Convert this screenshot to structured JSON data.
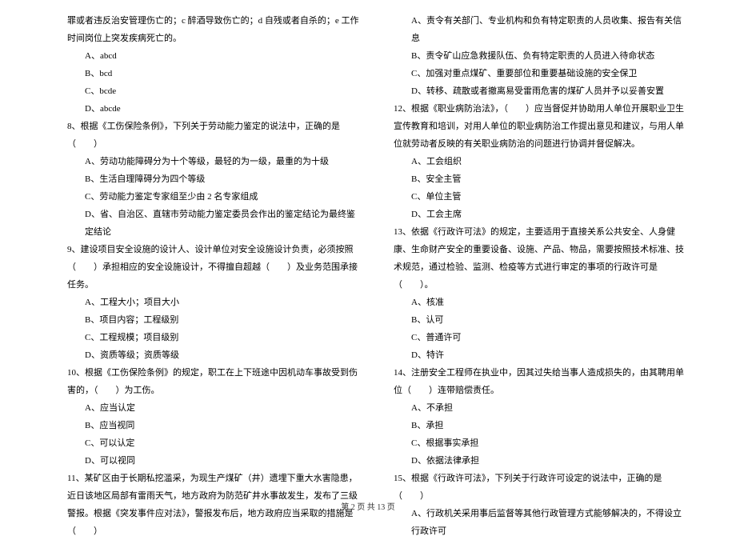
{
  "left": {
    "intro": "罪或者违反治安管理伤亡的；c 醉酒导致伤亡的；d 自残或者自杀的；e 工作时间岗位上突发疾病死亡的。",
    "q7_opts": [
      "A、abcd",
      "B、bcd",
      "C、bcde",
      "D、abcde"
    ],
    "q8_stem": "8、根据《工伤保险条例》，下列关于劳动能力鉴定的说法中，正确的是（　　）",
    "q8_opts": [
      "A、劳动功能障碍分为十个等级，最轻的为一级，最重的为十级",
      "B、生活自理障碍分为四个等级",
      "C、劳动能力鉴定专家组至少由 2 名专家组成",
      "D、省、自治区、直辖市劳动能力鉴定委员会作出的鉴定结论为最终鉴定结论"
    ],
    "q9_stem": "9、建设项目安全设施的设计人、设计单位对安全设施设计负责，必须按照（　　）承担相应的安全设施设计，不得擅自超越（　　）及业务范围承接任务。",
    "q9_opts": [
      "A、工程大小；项目大小",
      "B、项目内容；工程级别",
      "C、工程规模；项目级别",
      "D、资质等级；资质等级"
    ],
    "q10_stem": "10、根据《工伤保险条例》的规定，职工在上下班途中因机动车事故受到伤害的，（　　）为工伤。",
    "q10_opts": [
      "A、应当认定",
      "B、应当视同",
      "C、可以认定",
      "D、可以视同"
    ],
    "q11_stem": "11、某矿区由于长期私挖滥采，为现生产煤矿（井）遗埋下重大水害隐患，近日该地区局部有雷雨天气，地方政府为防范矿井水事故发生，发布了三级警报。根据《突发事件应对法》，警报发布后，地方政府应当采取的措施是（　　）"
  },
  "right": {
    "q11_opts": [
      "A、责令有关部门、专业机构和负有特定职责的人员收集、报告有关信息",
      "B、责令矿山应急救援队伍、负有特定职责的人员进入待命状态",
      "C、加强对重点煤矿、重要部位和重要基础设施的安全保卫",
      "D、转移、疏散或者撤离易受雷雨危害的煤矿人员并予以妥善安置"
    ],
    "q12_stem": "12、根据《职业病防治法》，（　　）应当督促并协助用人单位开展职业卫生宣传教育和培训，对用人单位的职业病防治工作提出意见和建议，与用人单位就劳动者反映的有关职业病防治的问题进行协调并督促解决。",
    "q12_opts": [
      "A、工会组织",
      "B、安全主管",
      "C、单位主管",
      "D、工会主席"
    ],
    "q13_stem": "13、依据《行政许可法》的规定，主要适用于直接关系公共安全、人身健康、生命财产安全的重要设备、设施、产品、物品，需要按照技术标准、技术规范，通过检验、监测、检疫等方式进行审定的事项的行政许可是（　　）。",
    "q13_opts": [
      "A、核准",
      "B、认可",
      "C、普通许可",
      "D、特许"
    ],
    "q14_stem": "14、注册安全工程师在执业中，因其过失给当事人造成损失的，由其聘用单位（　　）连带赔偿责任。",
    "q14_opts": [
      "A、不承担",
      "B、承担",
      "C、根据事实承担",
      "D、依据法律承担"
    ],
    "q15_stem": "15、根据《行政许可法》，下列关于行政许可设定的说法中，正确的是（　　）",
    "q15_opts": [
      "A、行政机关采用事后监督等其他行政管理方式能够解决的，不得设立行政许可"
    ]
  },
  "footer": "第 2 页 共 13 页"
}
